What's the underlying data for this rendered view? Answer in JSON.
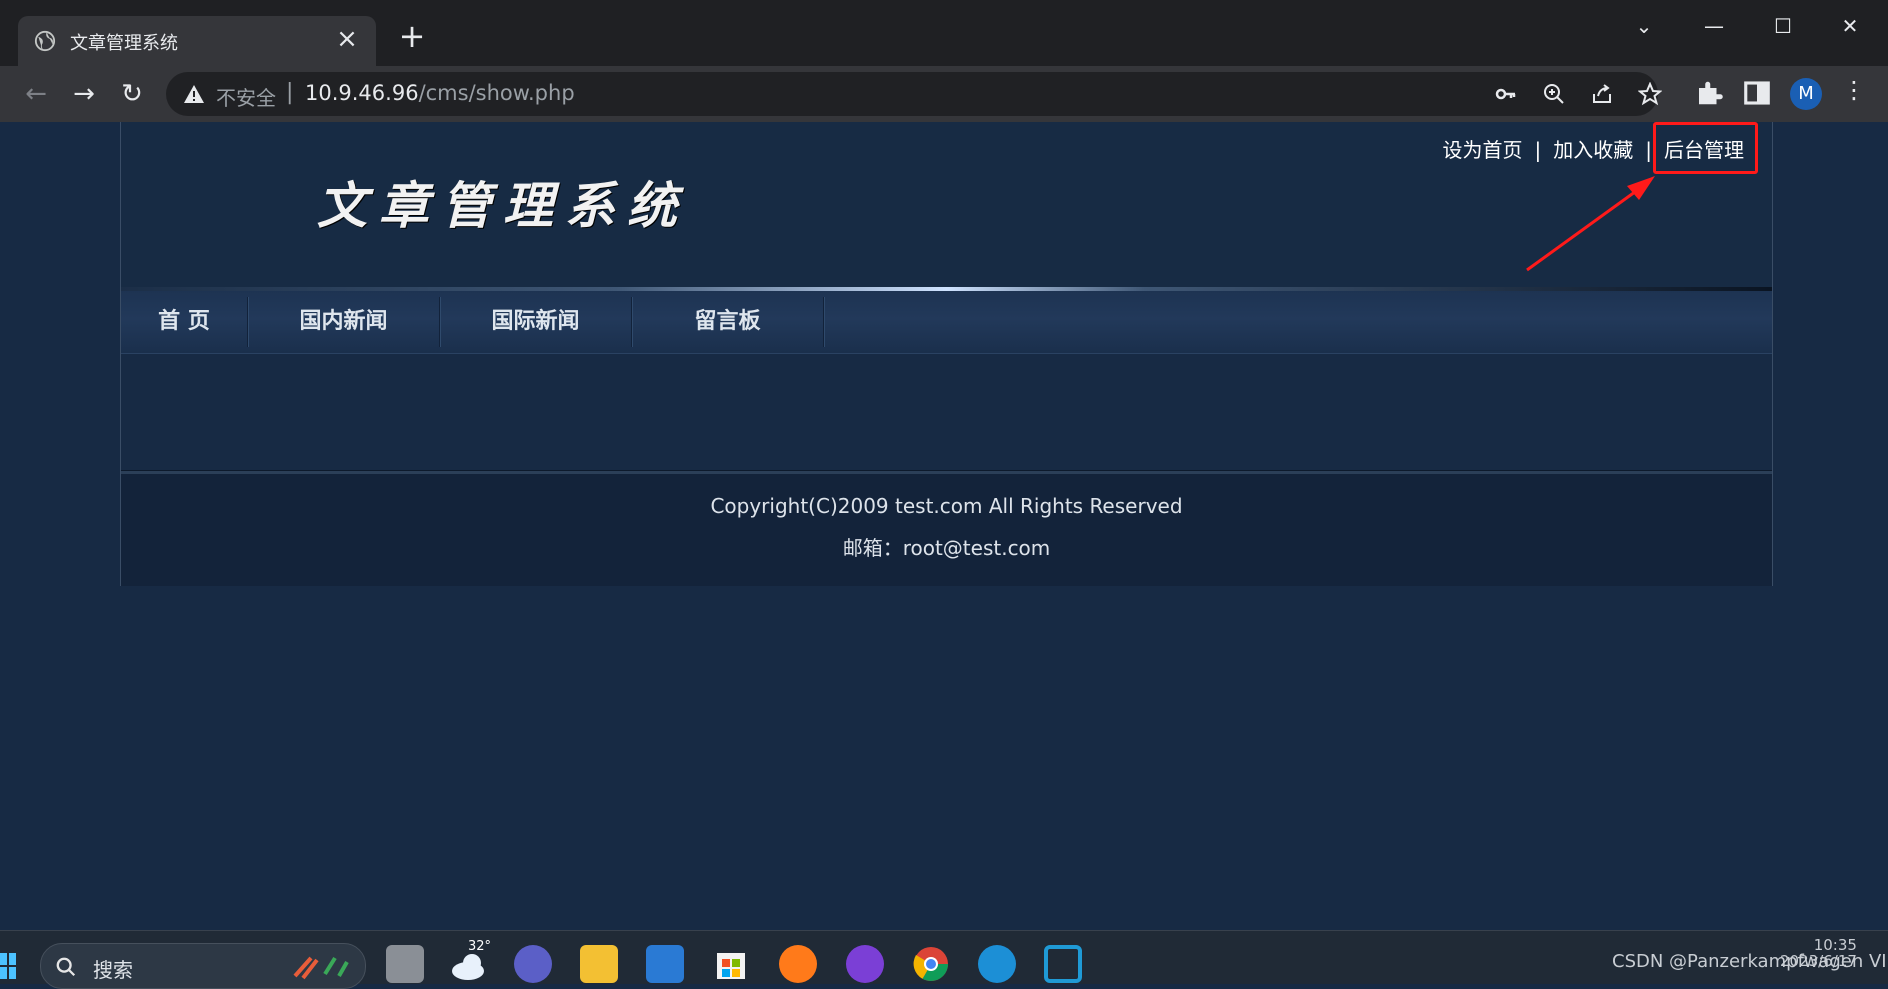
{
  "browser": {
    "tab_title": "文章管理系统",
    "security_label": "不安全",
    "url_host": "10.9.46.96",
    "url_path": "/cms/show.php",
    "profile_initial": "M"
  },
  "site": {
    "title": "文章管理系统",
    "top_links": [
      "设为首页",
      "加入收藏",
      "后台管理"
    ],
    "nav": [
      "首 页",
      "国内新闻",
      "国际新闻",
      "留言板"
    ],
    "copyright": "Copyright(C)2009 test.com All Rights Reserved",
    "email": "邮箱：root@test.com"
  },
  "taskbar": {
    "search_label": "搜索",
    "weather_temp": "32°",
    "watermark": "CSDN @Panzerkampfwagen VI",
    "time": "10:35",
    "date": "2023/6/17"
  },
  "colors": {
    "page_bg": "#172a44",
    "highlight": "#ff1a1a"
  },
  "icons": {
    "tab": "globe-icon",
    "security": "warning-triangle-icon",
    "omnibox": [
      "key-icon",
      "zoom-icon",
      "share-icon",
      "star-icon"
    ],
    "toolbar": [
      "extensions-icon",
      "side-panel-icon"
    ]
  }
}
